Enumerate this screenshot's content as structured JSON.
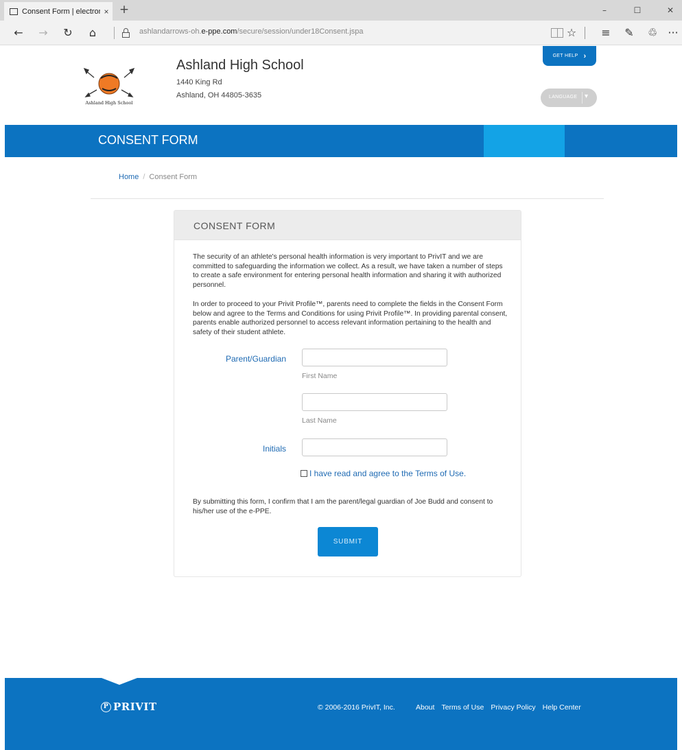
{
  "browser": {
    "tab_title": "Consent Form | electron",
    "tab_close": "×",
    "new_tab": "+",
    "url_prefix": "ashlandarrows-oh.",
    "url_domain": "e-ppe.com",
    "url_path": "/secure/session/under18Consent.jspa",
    "window_controls": [
      "–",
      "☐",
      "✕"
    ],
    "nav": {
      "back": "←",
      "forward": "→",
      "refresh": "↻",
      "home": "⌂",
      "favorite": "☆",
      "hub": "≡",
      "notes": "✎",
      "share": "♲",
      "more": "···"
    }
  },
  "header": {
    "logo_text": "Ashland High School",
    "school_name": "Ashland High School",
    "address_line1": "1440 King Rd",
    "address_line2": "Ashland, OH 44805-3635",
    "get_help": "GET HELP",
    "get_help_chevron": "›",
    "language": "LANGUAGE",
    "language_caret": "▾"
  },
  "band": {
    "title": "CONSENT FORM"
  },
  "breadcrumb": {
    "home": "Home",
    "separator": "/",
    "current": "Consent Form"
  },
  "panel": {
    "title": "CONSENT FORM",
    "para1": "The security of an athlete's personal health information is very important to PrivIT and we are committed to safeguarding the information we collect. As a result, we have taken a number of steps to create a safe environment for entering personal health information and sharing it with authorized personnel.",
    "para2": "In order to proceed to your Privit Profile™, parents need to complete the fields in the Consent Form below and agree to the Terms and Conditions for using Privit Profile™. In providing parental consent, parents enable authorized personnel to access relevant information pertaining to the health and safety of their student athlete.",
    "parent_label": "Parent/Guardian",
    "first_name_help": "First Name",
    "last_name_help": "Last Name",
    "initials_label": "Initials",
    "first_name_value": "",
    "last_name_value": "",
    "initials_value": "",
    "agree_prefix": "I have read and agree to the ",
    "agree_link": "Terms of Use",
    "agree_suffix": ".",
    "para3": "By submitting this form, I confirm that I am the parent/legal guardian of Joe Budd and consent to his/her use of the e-PPE.",
    "submit": "SUBMIT"
  },
  "footer": {
    "logo_mark": "P",
    "logo_text": "PRIVIT",
    "copyright": "© 2006-2016 PrivIT, Inc.",
    "links": [
      "About",
      "Terms of Use",
      "Privacy Policy",
      "Help Center"
    ]
  },
  "colors": {
    "brand_blue": "#0c73c1",
    "accent_blue": "#13a3e6",
    "link_blue": "#1e6ab3",
    "submit_blue": "#0c87d4"
  }
}
